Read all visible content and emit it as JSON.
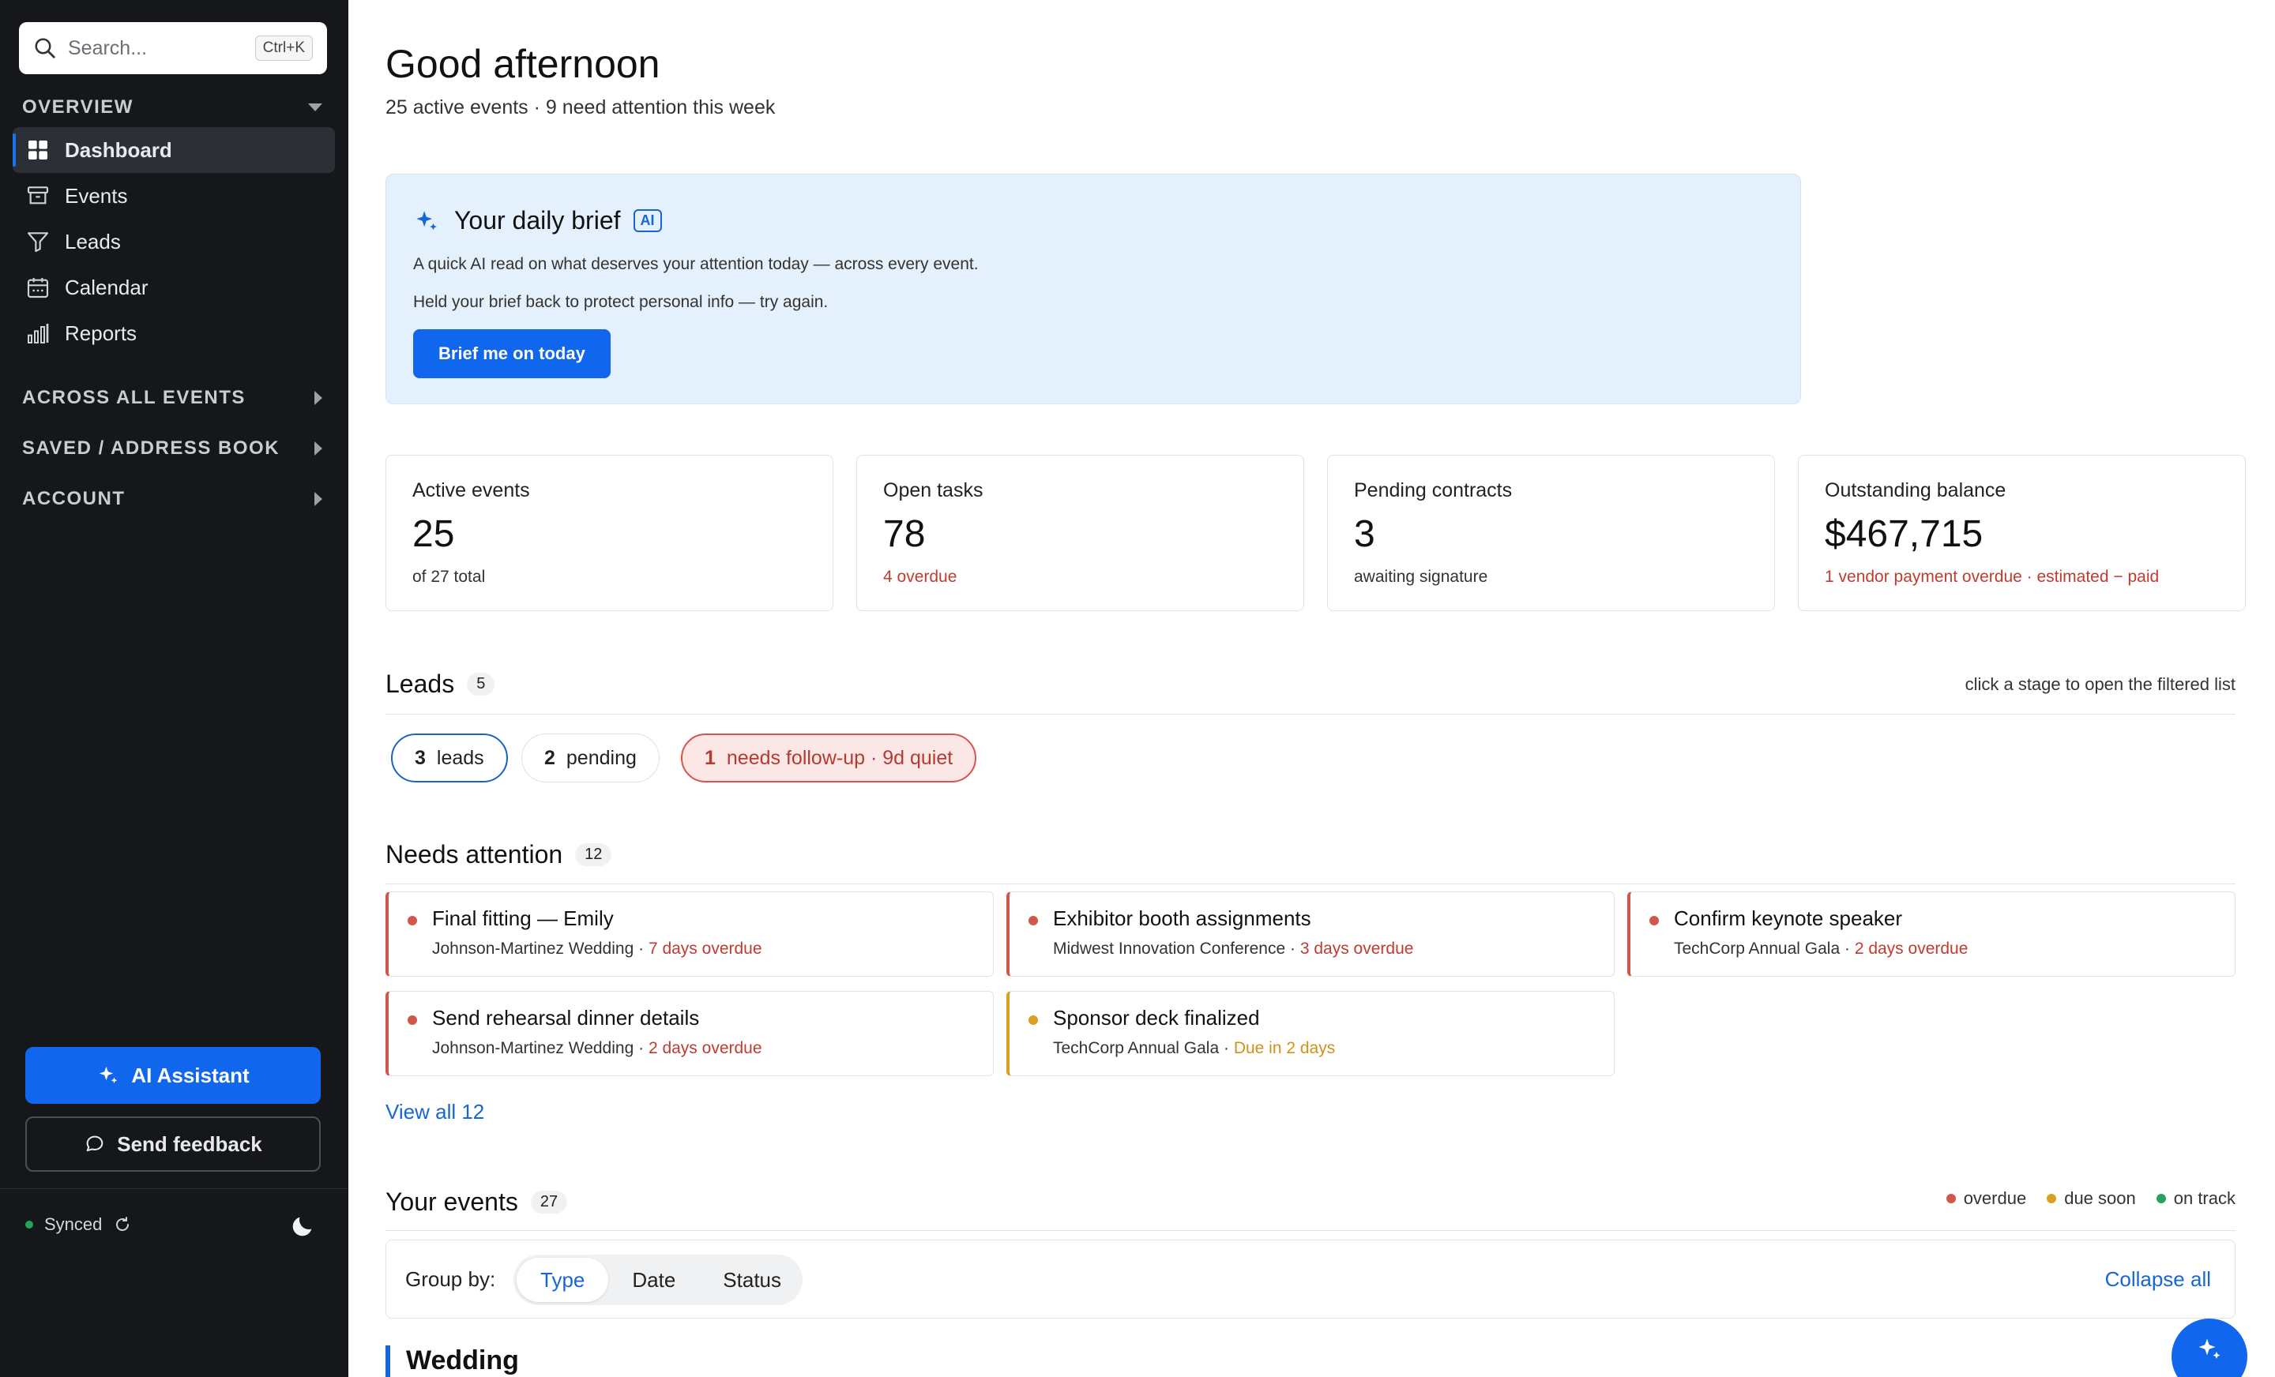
{
  "sidebar": {
    "search": {
      "placeholder": "Search...",
      "shortcut": "Ctrl+K"
    },
    "sections": {
      "overview": "OVERVIEW",
      "across": "ACROSS ALL EVENTS",
      "saved": "SAVED / ADDRESS BOOK",
      "account": "ACCOUNT"
    },
    "nav": [
      {
        "label": "Dashboard",
        "icon": "dashboard-icon",
        "active": true
      },
      {
        "label": "Events",
        "icon": "archive-icon"
      },
      {
        "label": "Leads",
        "icon": "funnel-icon"
      },
      {
        "label": "Calendar",
        "icon": "calendar-icon"
      },
      {
        "label": "Reports",
        "icon": "bar-chart-icon"
      }
    ],
    "ai_button": "AI Assistant",
    "feedback_button": "Send feedback",
    "sync_status": "Synced"
  },
  "header": {
    "greeting": "Good afternoon",
    "subtitle": "25 active events · 9 need attention this week"
  },
  "brief": {
    "title": "Your daily brief",
    "badge": "AI",
    "description": "A quick AI read on what deserves your attention today — across every event.",
    "message": "Held your brief back to protect personal info — try again.",
    "button": "Brief me on today"
  },
  "stats": [
    {
      "label": "Active events",
      "value": "25",
      "foot": "of 27 total",
      "foot_tone": "neutral"
    },
    {
      "label": "Open tasks",
      "value": "78",
      "foot": "4 overdue",
      "foot_tone": "red"
    },
    {
      "label": "Pending contracts",
      "value": "3",
      "foot": "awaiting signature",
      "foot_tone": "neutral"
    },
    {
      "label": "Outstanding balance",
      "value": "$467,715",
      "foot": "1 vendor payment overdue · estimated − paid",
      "foot_tone": "red"
    }
  ],
  "leads": {
    "title": "Leads",
    "count": "5",
    "hint": "click a stage to open the filtered list",
    "stages": [
      {
        "num": "3",
        "label": "leads"
      },
      {
        "num": "2",
        "label": "pending"
      },
      {
        "num": "1",
        "label": "needs follow-up · 9d quiet"
      }
    ]
  },
  "attention": {
    "title": "Needs attention",
    "count": "12",
    "items": [
      {
        "title": "Final fitting — Emily",
        "event": "Johnson-Martinez Wedding",
        "status": "7 days overdue",
        "tone": "red"
      },
      {
        "title": "Exhibitor booth assignments",
        "event": "Midwest Innovation Conference",
        "status": "3 days overdue",
        "tone": "red"
      },
      {
        "title": "Confirm keynote speaker",
        "event": "TechCorp Annual Gala",
        "status": "2 days overdue",
        "tone": "red"
      },
      {
        "title": "Send rehearsal dinner details",
        "event": "Johnson-Martinez Wedding",
        "status": "2 days overdue",
        "tone": "red"
      },
      {
        "title": "Sponsor deck finalized",
        "event": "TechCorp Annual Gala",
        "status": "Due in 2 days",
        "tone": "amber"
      }
    ],
    "view_all": "View all 12"
  },
  "events": {
    "title": "Your events",
    "count": "27",
    "legend": [
      {
        "label": "overdue",
        "color": "#d0584b"
      },
      {
        "label": "due soon",
        "color": "#d9a023"
      },
      {
        "label": "on track",
        "color": "#22a55b"
      }
    ],
    "group_by_label": "Group by:",
    "group_options": [
      "Type",
      "Date",
      "Status"
    ],
    "group_selected": "Type",
    "collapse_all": "Collapse all",
    "first_group": "Wedding"
  },
  "colors": {
    "accent": "#1166ee",
    "sidebar_bg": "#15171b",
    "overdue": "#c13b2f",
    "due_soon": "#d39116"
  }
}
